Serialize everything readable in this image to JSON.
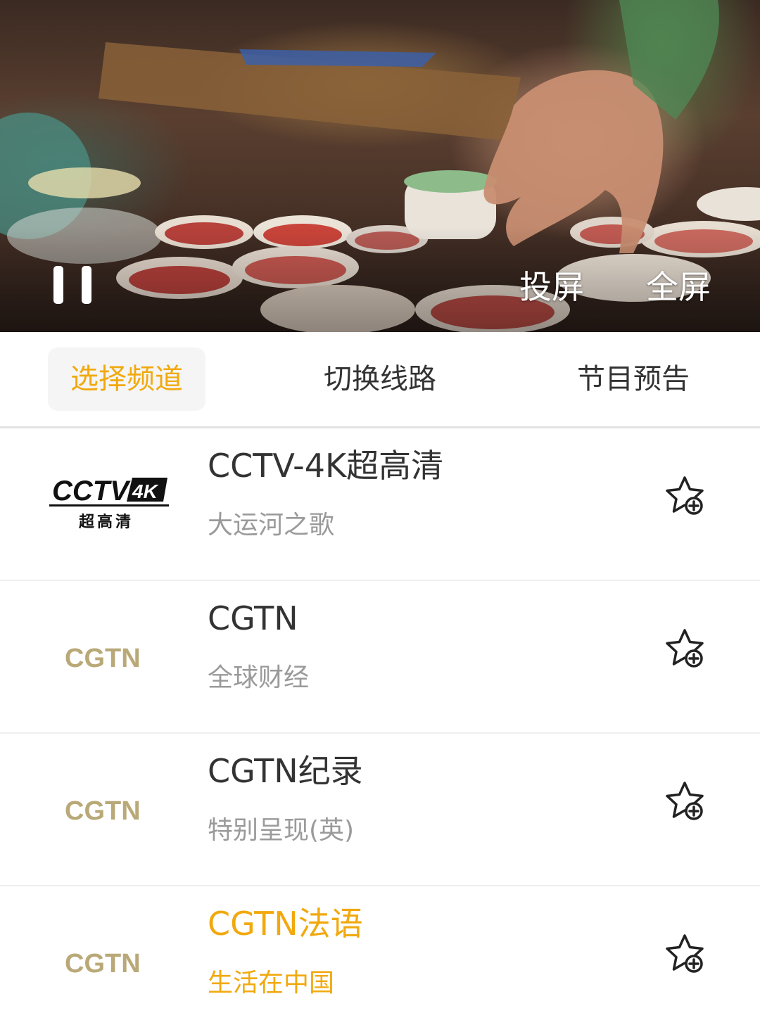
{
  "player": {
    "cast_label": "投屏",
    "fullscreen_label": "全屏",
    "pause_icon": "pause-icon"
  },
  "tabs": [
    {
      "label": "选择频道",
      "active": true
    },
    {
      "label": "切换线路",
      "active": false
    },
    {
      "label": "节目预告",
      "active": false
    }
  ],
  "channels": [
    {
      "name": "CCTV-4K超高清",
      "program": "大运河之歌",
      "logo": {
        "text": "CCTV",
        "badge": "4K",
        "sub": "超高清"
      },
      "fav_icon": "star-add-icon",
      "playing": false
    },
    {
      "name": "CGTN",
      "program": "全球财经",
      "logo": {
        "text": "CGTN"
      },
      "fav_icon": "star-add-icon",
      "playing": false
    },
    {
      "name": "CGTN纪录",
      "program": "特别呈现(英)",
      "logo": {
        "text": "CGTN"
      },
      "fav_icon": "star-add-icon",
      "playing": false
    },
    {
      "name": "CGTN法语",
      "program": "生活在中国",
      "logo": {
        "text": "CGTN"
      },
      "fav_icon": "star-add-icon",
      "playing": true
    }
  ],
  "colors": {
    "accent": "#f1a90f",
    "text_primary": "#333333",
    "text_secondary": "#9a9a9a",
    "cgtn_gold": "#b9a978"
  }
}
